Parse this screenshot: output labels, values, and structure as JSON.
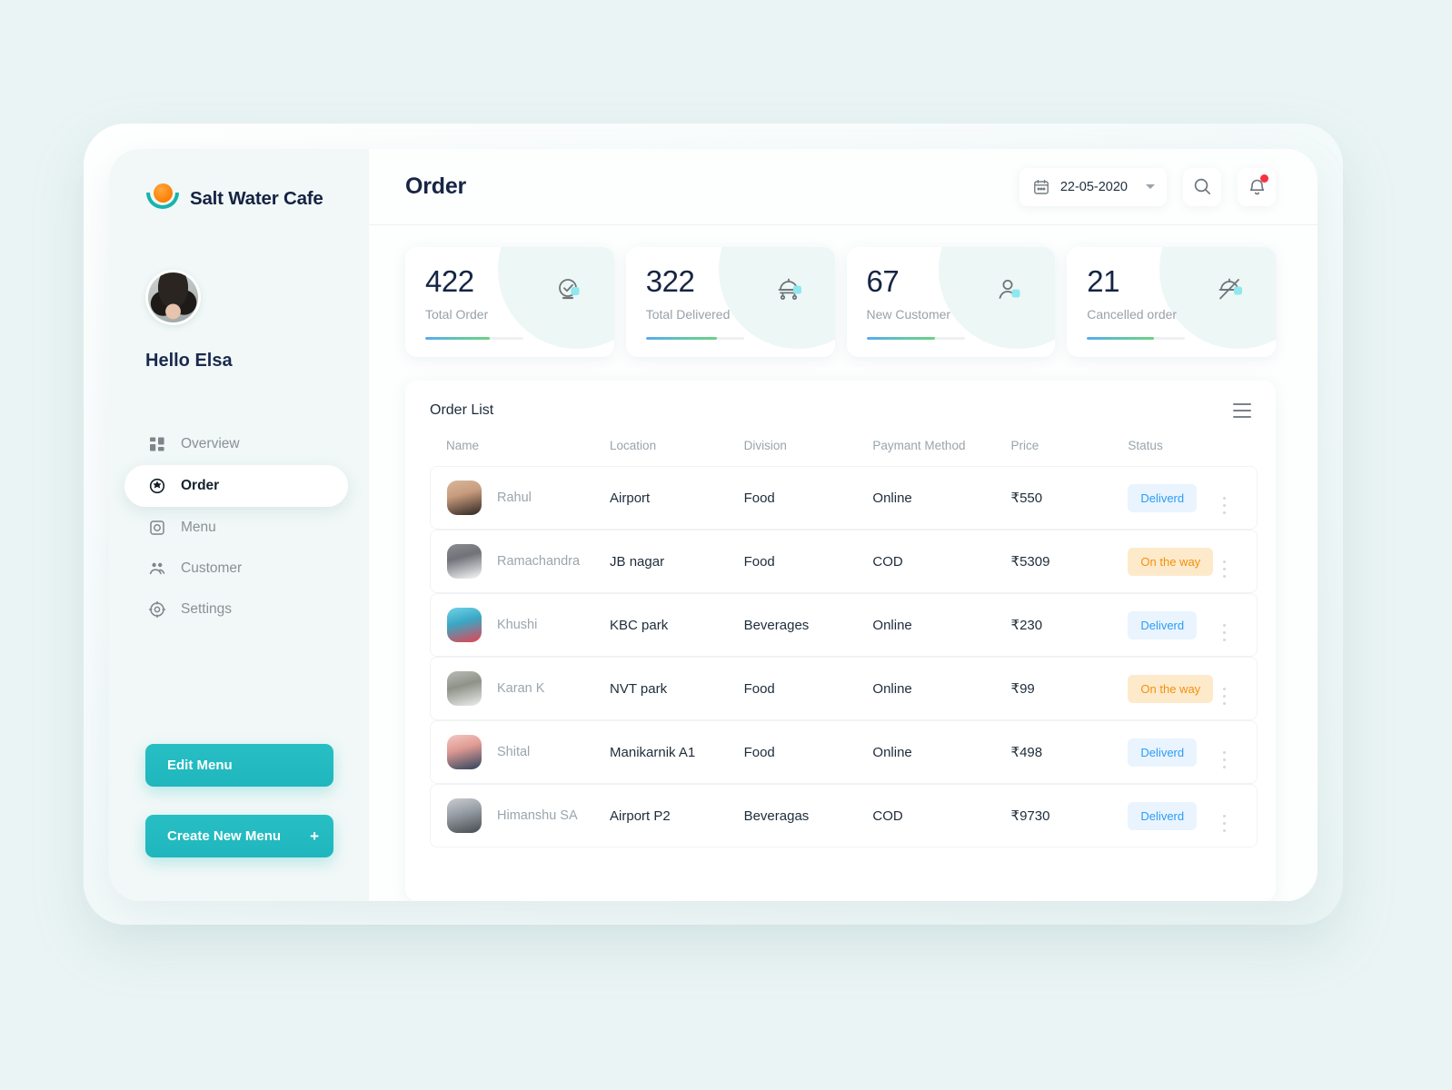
{
  "brand": {
    "name": "Salt Water Cafe",
    "logo_icon": "sun-bowl-logo-icon"
  },
  "profile": {
    "greeting": "Hello Elsa",
    "avatar": "user-avatar"
  },
  "sidebar": {
    "items": [
      {
        "label": "Overview",
        "icon": "dashboard-grid-icon",
        "active": false
      },
      {
        "label": "Order",
        "icon": "order-target-icon",
        "active": true
      },
      {
        "label": "Menu",
        "icon": "menu-square-icon",
        "active": false
      },
      {
        "label": "Customer",
        "icon": "customers-people-icon",
        "active": false
      },
      {
        "label": "Settings",
        "icon": "settings-gear-icon",
        "active": false
      }
    ],
    "buttons": {
      "edit_menu": "Edit Menu",
      "create_new_menu": "Create New Menu",
      "create_plus": "+"
    }
  },
  "topbar": {
    "title": "Order",
    "date": "22-05-2020",
    "calendar_icon": "calendar-icon",
    "dropdown_icon": "chevron-down-icon",
    "search_icon": "search-icon",
    "bell_icon": "notification-bell-icon",
    "has_notification": true
  },
  "stats": [
    {
      "value": "422",
      "label": "Total Order",
      "icon": "check-circle-icon",
      "progress": 66
    },
    {
      "value": "322",
      "label": "Total Delivered",
      "icon": "delivery-tray-icon",
      "progress": 72
    },
    {
      "value": "67",
      "label": "New Customer",
      "icon": "new-user-icon",
      "progress": 70
    },
    {
      "value": "21",
      "label": "Cancelled order",
      "icon": "cancelled-order-icon",
      "progress": 68
    }
  ],
  "order_list": {
    "title": "Order List",
    "menu_icon": "hamburger-menu-icon",
    "columns": [
      "Name",
      "Location",
      "Division",
      "Paymant Method",
      "Price",
      "Status",
      ""
    ],
    "rows": [
      {
        "name": "Rahul",
        "location": "Airport",
        "division": "Food",
        "payment": "Online",
        "price": "₹550",
        "status": "Deliverd",
        "status_type": "delivered"
      },
      {
        "name": "Ramachandra",
        "location": "JB nagar",
        "division": "Food",
        "payment": "COD",
        "price": "₹5309",
        "status": "On the way",
        "status_type": "ontheway"
      },
      {
        "name": "Khushi",
        "location": "KBC park",
        "division": "Beverages",
        "payment": "Online",
        "price": "₹230",
        "status": "Deliverd",
        "status_type": "delivered"
      },
      {
        "name": "Karan K",
        "location": "NVT park",
        "division": "Food",
        "payment": "Online",
        "price": "₹99",
        "status": "On the way",
        "status_type": "ontheway"
      },
      {
        "name": "Shital",
        "location": "Manikarnik A1",
        "division": "Food",
        "payment": "Online",
        "price": "₹498",
        "status": "Deliverd",
        "status_type": "delivered"
      },
      {
        "name": "Himanshu SA",
        "location": "Airport P2",
        "division": "Beveragas",
        "payment": "COD",
        "price": "₹9730",
        "status": "Deliverd",
        "status_type": "delivered"
      }
    ]
  },
  "colors": {
    "accent_teal": "#22bcc1",
    "logo_orange": "#fd8109",
    "price_green": "#28b978",
    "badge_delivered_text": "#2d9cf5",
    "badge_delivered_bg": "#e9f4fe",
    "badge_ontheway_text": "#f4900c",
    "badge_ontheway_bg": "#fdeacb",
    "page_bg": "#eaf4f4",
    "sidebar_bg": "#f1f8f7",
    "title_navy": "#162544"
  }
}
